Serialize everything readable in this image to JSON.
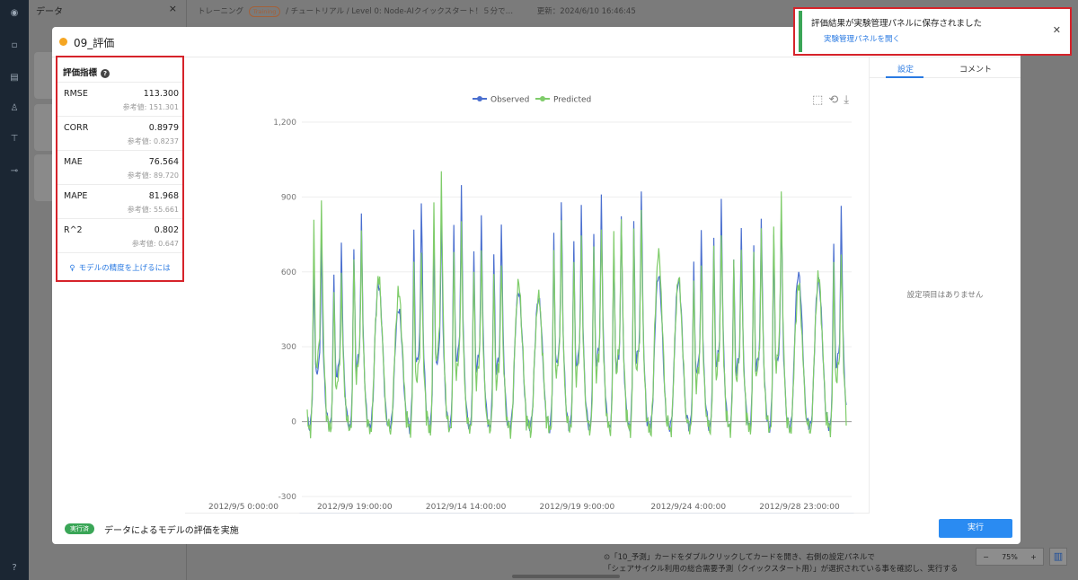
{
  "background": {
    "left_panel_title": "データ",
    "topbar_text_prefix": "トレーニング",
    "topbar_badge": "Training",
    "topbar_text_rest": "/ チュートリアル / Level 0: Node-AIクイックスタート！５分で…",
    "topbar_updated": "更新：2024/6/10 16:46:45",
    "bottom_text_line1": "⊙「10_予測」カードをダブルクリックしてカードを開き、右側の設定パネルで",
    "bottom_text_line2": "「シェアサイクル利用の総合需要予測（クイックスタート用）」が選択されている事を確認し、実行する",
    "zoom_level": "75%",
    "zoom_minus": "−",
    "zoom_plus": "+"
  },
  "modal": {
    "title": "09_評価",
    "status_color": "#f5a623",
    "metrics_title": "評価指標",
    "metrics": [
      {
        "name": "RMSE",
        "value": "113.300",
        "ref": "参考値: 151.301"
      },
      {
        "name": "CORR",
        "value": "0.8979",
        "ref": "参考値: 0.8237"
      },
      {
        "name": "MAE",
        "value": "76.564",
        "ref": "参考値: 89.720"
      },
      {
        "name": "MAPE",
        "value": "81.968",
        "ref": "参考値: 55.661"
      },
      {
        "name": "R^2",
        "value": "0.802",
        "ref": "参考値: 0.647"
      }
    ],
    "improve_link": "モデルの精度を上げるには",
    "tabs": {
      "settings": "設定",
      "comment": "コメント"
    },
    "empty_settings": "設定項目はありません",
    "footer_status": "実行済",
    "footer_description": "データによるモデルの評価を実施",
    "run_button": "実行"
  },
  "toast": {
    "title": "評価結果が実験管理パネルに保存されました",
    "link": "実験管理パネルを開く"
  },
  "chart_data": {
    "type": "line",
    "series": [
      {
        "name": "Observed",
        "color": "#4a6fcf"
      },
      {
        "name": "Predicted",
        "color": "#7fcc6a"
      }
    ],
    "ylim": [
      -300,
      1200
    ],
    "yticks": [
      -300,
      0,
      300,
      600,
      900,
      1200
    ],
    "yticklabels": [
      "-300",
      "0",
      "300",
      "600",
      "900",
      "1,200"
    ],
    "xticklabels": [
      "2012/9/5 0:00:00",
      "2012/9/9 19:00:00",
      "2012/9/14 14:00:00",
      "2012/9/19 9:00:00",
      "2012/9/24 4:00:00",
      "2012/9/28 23:00:00"
    ],
    "daily_peaks": [
      {
        "obs": 720,
        "pred": 920
      },
      {
        "obs": 700,
        "pred": 610
      },
      {
        "obs": 830,
        "pred": 790
      },
      {
        "obs": 780,
        "pred": 820
      },
      {
        "obs": 640,
        "pred": 740
      },
      {
        "obs": 880,
        "pred": 720
      },
      {
        "obs": 860,
        "pred": 1020
      },
      {
        "obs": 930,
        "pred": 820
      },
      {
        "obs": 820,
        "pred": 730
      },
      {
        "obs": 800,
        "pred": 690
      },
      {
        "obs": 740,
        "pred": 790
      },
      {
        "obs": 700,
        "pred": 720
      },
      {
        "obs": 870,
        "pred": 820
      },
      {
        "obs": 850,
        "pred": 780
      },
      {
        "obs": 900,
        "pred": 830
      },
      {
        "obs": 830,
        "pred": 870
      },
      {
        "obs": 940,
        "pred": 880
      },
      {
        "obs": 830,
        "pred": 960
      },
      {
        "obs": 800,
        "pred": 820
      },
      {
        "obs": 750,
        "pred": 680
      },
      {
        "obs": 880,
        "pred": 810
      },
      {
        "obs": 780,
        "pred": 730
      },
      {
        "obs": 830,
        "pred": 790
      },
      {
        "obs": 860,
        "pred": 940
      },
      {
        "obs": 840,
        "pred": 780
      },
      {
        "obs": 800,
        "pred": 830
      },
      {
        "obs": 850,
        "pred": 720
      }
    ]
  }
}
